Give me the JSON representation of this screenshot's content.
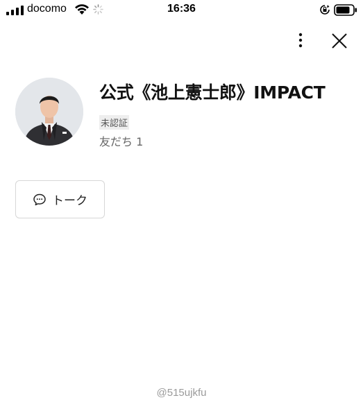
{
  "status_bar": {
    "carrier": "docomo",
    "time": "16:36"
  },
  "icons": {
    "signal": "signal-icon",
    "wifi": "wifi-icon",
    "activity": "spinner-icon",
    "rotation_lock": "rotation-lock-icon",
    "battery": "battery-icon",
    "menu": "more-vertical-icon",
    "close": "close-icon",
    "talk": "chat-bubble-icon"
  },
  "profile": {
    "name": "公式《池上憲士郎》IMPACT",
    "verification": "未認証",
    "friends": "友だち 1"
  },
  "actions": {
    "talk_label": "トーク"
  },
  "footer": {
    "handle": "@515ujkfu"
  },
  "colors": {
    "text_primary": "#111111",
    "text_secondary": "#666666",
    "handle": "#9a9a9a",
    "border": "#d6d6d6"
  }
}
